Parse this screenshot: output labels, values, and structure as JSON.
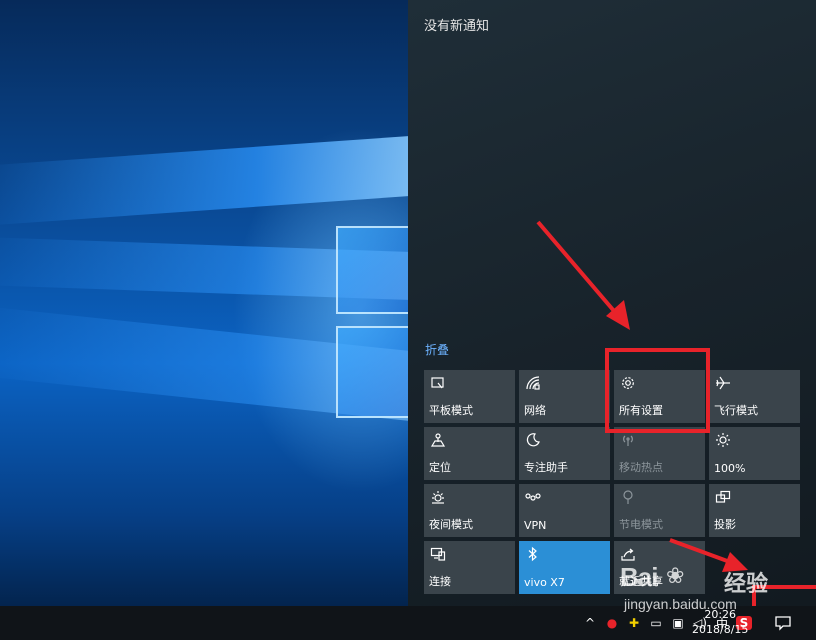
{
  "action_center": {
    "no_notifications": "没有新通知",
    "collapse_label": "折叠",
    "tiles": [
      {
        "label": "平板模式",
        "icon": "tablet-mode-icon",
        "state": "off"
      },
      {
        "label": "网络",
        "icon": "network-icon",
        "state": "off"
      },
      {
        "label": "所有设置",
        "icon": "gear-icon",
        "state": "off"
      },
      {
        "label": "飞行模式",
        "icon": "airplane-icon",
        "state": "off"
      },
      {
        "label": "定位",
        "icon": "location-icon",
        "state": "off"
      },
      {
        "label": "专注助手",
        "icon": "moon-icon",
        "state": "off"
      },
      {
        "label": "移动热点",
        "icon": "hotspot-icon",
        "state": "disabled"
      },
      {
        "label": "100%",
        "icon": "brightness-icon",
        "state": "off"
      },
      {
        "label": "夜间模式",
        "icon": "night-light-icon",
        "state": "off"
      },
      {
        "label": "VPN",
        "icon": "vpn-icon",
        "state": "off"
      },
      {
        "label": "节电模式",
        "icon": "battery-saver-icon",
        "state": "disabled"
      },
      {
        "label": "投影",
        "icon": "project-icon",
        "state": "off"
      },
      {
        "label": "连接",
        "icon": "connect-icon",
        "state": "off"
      },
      {
        "label": "vivo X7",
        "icon": "bluetooth-icon",
        "state": "on"
      },
      {
        "label": "就近共享",
        "icon": "nearby-share-icon",
        "state": "off"
      }
    ]
  },
  "taskbar": {
    "ime_label": "中",
    "sogou_label": "S",
    "time": "20:26",
    "date": "2018/8/15"
  },
  "watermark": {
    "brand": "Bai",
    "brand_cn": "经验",
    "url": "jingyan.baidu.com"
  },
  "colors": {
    "accent": "#2b8fd6",
    "highlight": "#e8232a",
    "tile": "#3a444b"
  }
}
